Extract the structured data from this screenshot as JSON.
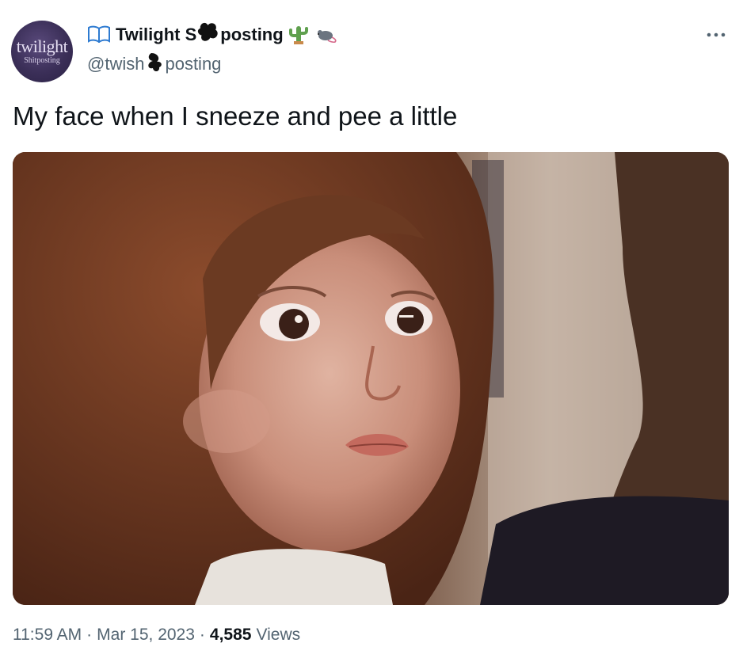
{
  "author": {
    "display_name_a": "Twilight S",
    "display_name_b": "posting",
    "handle_a": "@twish",
    "handle_b": "posting",
    "avatar_text_main": "twilight",
    "avatar_text_sub": "Shitposting"
  },
  "tweet": {
    "text": "My face when I sneeze and pee a little"
  },
  "meta": {
    "time": "11:59 AM",
    "sep1": "·",
    "date": "Mar 15, 2023",
    "sep2": "·",
    "views_count": "4,585",
    "views_label": "Views"
  },
  "icons": [
    "book-emoji-icon",
    "scribble-redaction-icon",
    "cactus-emoji-icon",
    "rat-emoji-icon",
    "more-options-icon"
  ],
  "colors": {
    "text_primary": "#0f1419",
    "text_secondary": "#536471",
    "background": "#ffffff"
  }
}
